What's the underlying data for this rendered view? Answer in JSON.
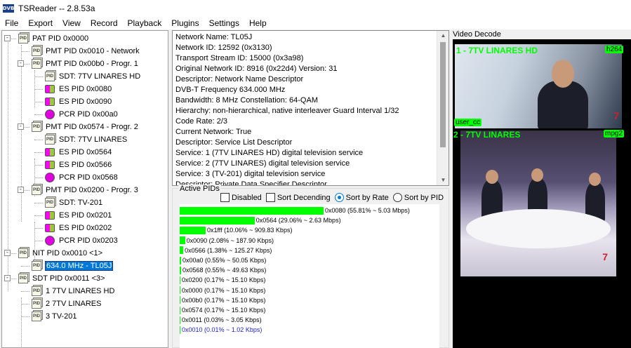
{
  "app": {
    "title": "TSReader -- 2.8.53a",
    "icon_text": "DVB"
  },
  "menu": [
    "File",
    "Export",
    "View",
    "Record",
    "Playback",
    "Plugins",
    "Settings",
    "Help"
  ],
  "tree": {
    "nodes": [
      {
        "label": "PAT PID 0x0000",
        "icon": "doc-icon",
        "level": 0,
        "expander": "-"
      },
      {
        "label": "PMT PID 0x0010 - Network",
        "icon": "doc-icon",
        "level": 1
      },
      {
        "label": "PMT PID 0x00b0 - Progr. 1",
        "icon": "doc-icon",
        "level": 1,
        "expander": "-"
      },
      {
        "label": "SDT: 7TV LINARES HD",
        "icon": "doc-icon",
        "level": 2
      },
      {
        "label": "ES PID 0x0080",
        "icon": "es-icon",
        "level": 2
      },
      {
        "label": "ES PID 0x0090",
        "icon": "es-icon",
        "level": 2
      },
      {
        "label": "PCR PID 0x00a0",
        "icon": "pcr-icon",
        "level": 2
      },
      {
        "label": "PMT PID 0x0574 - Progr. 2",
        "icon": "doc-icon",
        "level": 1,
        "expander": "-"
      },
      {
        "label": "SDT: 7TV LINARES",
        "icon": "doc-icon",
        "level": 2
      },
      {
        "label": "ES PID 0x0564",
        "icon": "es-icon",
        "level": 2
      },
      {
        "label": "ES PID 0x0566",
        "icon": "es-icon",
        "level": 2
      },
      {
        "label": "PCR PID 0x0568",
        "icon": "pcr-icon",
        "level": 2
      },
      {
        "label": "PMT PID 0x0200 - Progr. 3",
        "icon": "doc-icon",
        "level": 1,
        "expander": "-"
      },
      {
        "label": "SDT: TV-201",
        "icon": "doc-icon",
        "level": 2
      },
      {
        "label": "ES PID 0x0201",
        "icon": "es-icon",
        "level": 2
      },
      {
        "label": "ES PID 0x0202",
        "icon": "es-icon",
        "level": 2
      },
      {
        "label": "PCR PID 0x0203",
        "icon": "pcr-icon",
        "level": 2
      },
      {
        "label": "NIT PID 0x0010 <1>",
        "icon": "doc-icon",
        "level": 0,
        "expander": "-"
      },
      {
        "label": "634.0 MHz - TL05J",
        "icon": "doc-icon",
        "level": 1,
        "selected": true
      },
      {
        "label": "SDT PID 0x0011 <3>",
        "icon": "doc-icon",
        "level": 0,
        "expander": "-"
      },
      {
        "label": "1 7TV LINARES HD",
        "icon": "doc-icon",
        "level": 1
      },
      {
        "label": "2 7TV LINARES",
        "icon": "doc-icon",
        "level": 1
      },
      {
        "label": "3 TV-201",
        "icon": "doc-icon",
        "level": 1
      }
    ]
  },
  "info": {
    "lines": [
      "Network Name: TL05J",
      "Network ID: 12592 (0x3130)",
      "Transport Stream ID: 15000 (0x3a98)",
      "Original Network ID: 8916 (0x22d4) Version: 31",
      "Descriptor: Network Name Descriptor",
      "DVB-T Frequency 634.000 MHz",
      "Bandwidth: 8 MHz Constellation: 64-QAM",
      "Hierarchy: non-hierarchical, native interleaver Guard Interval 1/32",
      "Code Rate: 2/3",
      "Current Network: True",
      "Descriptor: Service List Descriptor",
      "Service: 1 (7TV LINARES HD) digital television service",
      "Service: 2 (7TV LINARES) digital television service",
      "Service: 3 (TV-201) digital television service",
      "Descriptor: Private Data Specifier Descriptor"
    ]
  },
  "active_pids": {
    "legend": "Active PIDs",
    "disabled_label": "Disabled",
    "sort_descending_label": "Sort Decending",
    "sort_rate_label": "Sort by Rate",
    "sort_pid_label": "Sort by PID",
    "sort_selected": "rate",
    "rows": [
      {
        "text": "0x0080 (55.81% ~ 5.03 Mbps)",
        "percent": 55.81
      },
      {
        "text": "0x0564 (29.06% ~ 2.63 Mbps)",
        "percent": 29.06
      },
      {
        "text": "0x1fff (10.06% ~ 909.83 Kbps)",
        "percent": 10.06
      },
      {
        "text": "0x0090 (2.08% ~ 187.90 Kbps)",
        "percent": 2.08
      },
      {
        "text": "0x0566 (1.38% ~ 125.27 Kbps)",
        "percent": 1.38
      },
      {
        "text": "0x00a0 (0.55% ~ 50.05 Kbps)",
        "percent": 0.55
      },
      {
        "text": "0x0568 (0.55% ~ 49.63 Kbps)",
        "percent": 0.55
      },
      {
        "text": "0x0200 (0.17% ~ 15.10 Kbps)",
        "percent": 0.17
      },
      {
        "text": "0x0000 (0.17% ~ 15.10 Kbps)",
        "percent": 0.17
      },
      {
        "text": "0x00b0 (0.17% ~ 15.10 Kbps)",
        "percent": 0.17
      },
      {
        "text": "0x0574 (0.17% ~ 15.10 Kbps)",
        "percent": 0.17
      },
      {
        "text": "0x0011 (0.03% ~ 3.05 Kbps)",
        "percent": 0.03
      },
      {
        "text": "0x0010 (0.01% ~ 1.02 Kbps)",
        "percent": 0.01,
        "highlight": true
      }
    ]
  },
  "video": {
    "legend": "Video Decode",
    "stream1": {
      "label": "1 - 7TV LINARES HD",
      "codec": "h264",
      "tag": "user_cc"
    },
    "stream2": {
      "label": "2 - 7TV LINARES",
      "codec": "mpg2"
    },
    "logo_text": "7"
  },
  "colors": {
    "bar": "#00ff00",
    "selection": "#0078d7",
    "video_overlay": "#00ff00"
  }
}
